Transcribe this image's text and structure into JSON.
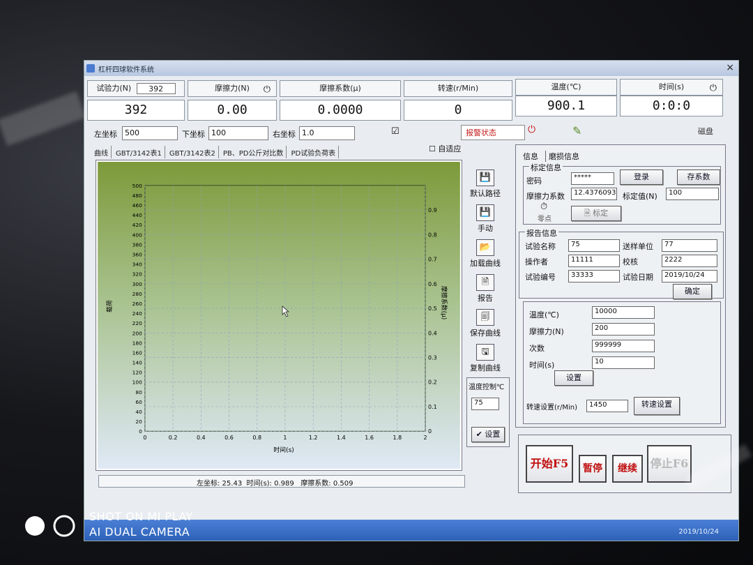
{
  "window": {
    "title": "杠杆四球软件系统"
  },
  "header": {
    "load": {
      "label": "试验力(N)",
      "select": "392",
      "value": "392"
    },
    "friction_force": {
      "label": "摩擦力(N)",
      "value": "0.00"
    },
    "friction_coef": {
      "label": "摩擦系数(μ)",
      "value": "0.0000"
    },
    "speed": {
      "label": "转速(r/Min)",
      "value": "0"
    },
    "temperature": {
      "label": "温度(℃)",
      "value": "900.1"
    },
    "time": {
      "label": "时间(s)",
      "value": "0:0:0"
    }
  },
  "axes_bar": {
    "left_label": "左坐标",
    "left_value": "500",
    "bottom_label": "下坐标",
    "bottom_value": "100",
    "right_label": "右坐标",
    "right_value": "1.0",
    "checkbox_checked": "☑",
    "alarm_label": "报警状态",
    "save_text": "磁盘"
  },
  "tabs": [
    "曲线",
    "GBT/3142表1",
    "GBT/3142表2",
    "PB、PD公斤对比数",
    "PD试验负荷表"
  ],
  "auto_adapt": "自适应",
  "chart_data": {
    "type": "line",
    "title": "",
    "xlabel": "时间(s)",
    "ylabel": "载荷",
    "y2label": "摩擦系数(μ)",
    "xlim": [
      0,
      2
    ],
    "ylim": [
      0,
      500
    ],
    "y2lim": [
      0,
      1
    ],
    "x_ticks": [
      "0",
      "0.2",
      "0.4",
      "0.6",
      "0.8",
      "1",
      "1.2",
      "1.4",
      "1.6",
      "1.8",
      "2"
    ],
    "y_ticks": [
      "0",
      "20",
      "40",
      "60",
      "80",
      "100",
      "120",
      "140",
      "160",
      "180",
      "200",
      "220",
      "240",
      "260",
      "280",
      "300",
      "320",
      "340",
      "360",
      "380",
      "400",
      "420",
      "440",
      "460",
      "480",
      "500"
    ],
    "y2_ticks": [
      "0",
      "0.1",
      "0.2",
      "0.3",
      "0.4",
      "0.5",
      "0.6",
      "0.7",
      "0.8",
      "0.9"
    ],
    "grid": true,
    "series": []
  },
  "tools": [
    {
      "icon": "💾",
      "label": "默认路径"
    },
    {
      "icon": "💾",
      "label": "手动"
    },
    {
      "icon": "📂",
      "label": "加载曲线"
    },
    {
      "icon": "🗎",
      "label": "报告"
    },
    {
      "icon": "🗐",
      "label": "保存曲线"
    },
    {
      "icon": "🖫",
      "label": "复制曲线"
    }
  ],
  "temp_control": {
    "title": "温度控制℃",
    "value": "75",
    "button": "设置"
  },
  "right_tabs": [
    "信息",
    "磨损信息"
  ],
  "calibration": {
    "title": "标定信息",
    "password_label": "密码",
    "password_value": "*****",
    "login": "登录",
    "save_coef": "存系数",
    "coef_label": "摩擦力系数",
    "coef_value": "12.43760934",
    "calib_label": "标定值(N)",
    "calib_value": "100",
    "zero": "零点",
    "calibrate": "标定"
  },
  "report": {
    "title": "报告信息",
    "name_label": "试验名称",
    "name_value": "75",
    "unit_label": "送样单位",
    "unit_value": "77",
    "operator_label": "操作者",
    "operator_value": "11111",
    "checker_label": "校核",
    "checker_value": "2222",
    "no_label": "试验编号",
    "no_value": "33333",
    "date_label": "试验日期",
    "date_value": "2019/10/24",
    "confirm": "确定"
  },
  "limits": {
    "temp_label": "温度(℃)",
    "temp_value": "10000",
    "friction_label": "摩擦力(N)",
    "friction_value": "200",
    "count_label": "次数",
    "count_value": "999999",
    "time_label": "时间(s)",
    "time_value": "10",
    "set": "设置",
    "speed_label": "转速设置(r/Min)",
    "speed_value": "1450",
    "speed_set": "转速设置"
  },
  "actions": {
    "start": "开始F5",
    "pause": "暂停",
    "resume": "继续",
    "stop": "停止F6"
  },
  "status": {
    "cursor": "左坐标: 25.43",
    "time_label": "时间(s):",
    "time_value": "0.989",
    "coef_label": "摩擦系数:",
    "coef_value": "0.509"
  },
  "taskbar": {
    "date": "2019/10/24"
  },
  "watermark": {
    "line1": "SHOT ON MI PLAY",
    "line2": "AI DUAL CAMERA"
  },
  "colors": {
    "plot_top": "#7d9a3a",
    "plot_bottom": "#dfe9f6",
    "alarm": "#c51b1b",
    "taskbar": "#2b5fb5"
  }
}
